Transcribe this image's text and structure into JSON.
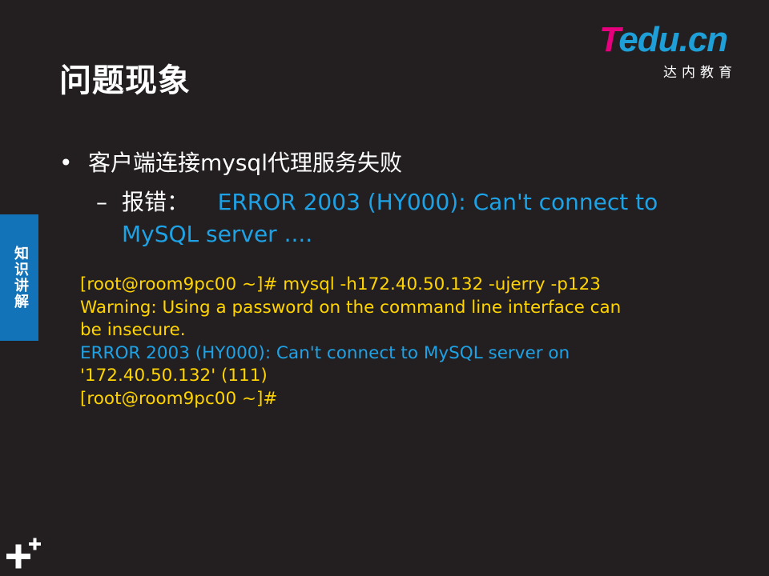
{
  "slide": {
    "title": "问题现象"
  },
  "logo": {
    "brand_t": "T",
    "brand_rest": "edu.cn",
    "subtitle": "达内教育",
    "colors": {
      "t": "#e6007e",
      "rest": "#1e9fd8"
    }
  },
  "side_tab": {
    "label": "知识讲解",
    "color": "#1373b8"
  },
  "content": {
    "bullet_marker": "•",
    "bullet": "客户端连接mysql代理服务失败",
    "sub_marker": "–",
    "sub_label": "报错：",
    "sub_error_line1": "ERROR 2003 (HY000): Can't connect to",
    "sub_error_line2": "MySQL server ...."
  },
  "terminal": {
    "lines": [
      {
        "text": "[root@room9pc00 ~]# mysql -h172.40.50.132 -ujerry -p123",
        "color": "yellow"
      },
      {
        "text": "Warning: Using a password on the command line interface can",
        "color": "yellow"
      },
      {
        "text": "be insecure.",
        "color": "yellow"
      },
      {
        "text": "ERROR 2003 (HY000): Can't connect to MySQL server on",
        "color": "blue"
      },
      {
        "text": "'172.40.50.132' (111)",
        "color": "yellow"
      },
      {
        "text": "[root@room9pc00 ~]#",
        "color": "yellow"
      }
    ]
  },
  "colors": {
    "background": "#231f20",
    "text": "#ffffff",
    "terminal_text": "#ffd400",
    "error_text": "#1ea2e6"
  },
  "icons": {
    "corner": "plus-decoration-icon"
  }
}
